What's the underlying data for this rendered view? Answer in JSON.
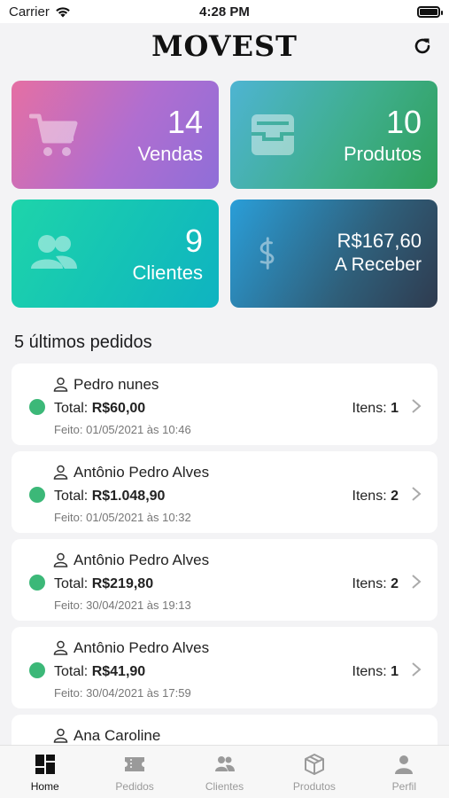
{
  "status": {
    "carrier": "Carrier",
    "time": "4:28 PM",
    "battery_level": 1.0
  },
  "header": {
    "logo": "MOVEST",
    "refresh_icon": "refresh-icon"
  },
  "cards": {
    "vendas": {
      "value": "14",
      "label": "Vendas",
      "icon": "cart-icon"
    },
    "produtos": {
      "value": "10",
      "label": "Produtos",
      "icon": "inbox-tray-icon"
    },
    "clientes": {
      "value": "9",
      "label": "Clientes",
      "icon": "users-icon"
    },
    "receber": {
      "value": "R$167,60",
      "label": "A Receber",
      "icon": "dollar-icon"
    }
  },
  "orders_section": {
    "title": "5 últimos pedidos"
  },
  "orders": [
    {
      "name": "Pedro nunes",
      "total_label": "Total:",
      "total": "R$60,00",
      "date": "Feito: 01/05/2021 às 10:46",
      "itens_label": "Itens:",
      "itens": "1",
      "status_color": "#3cb878"
    },
    {
      "name": "Antônio Pedro Alves",
      "total_label": "Total:",
      "total": "R$1.048,90",
      "date": "Feito: 01/05/2021 às 10:32",
      "itens_label": "Itens:",
      "itens": "2",
      "status_color": "#3cb878"
    },
    {
      "name": "Antônio Pedro Alves",
      "total_label": "Total:",
      "total": "R$219,80",
      "date": "Feito: 30/04/2021 às 19:13",
      "itens_label": "Itens:",
      "itens": "2",
      "status_color": "#3cb878"
    },
    {
      "name": "Antônio Pedro Alves",
      "total_label": "Total:",
      "total": "R$41,90",
      "date": "Feito: 30/04/2021 às 17:59",
      "itens_label": "Itens:",
      "itens": "1",
      "status_color": "#3cb878"
    },
    {
      "name": "Ana Caroline"
    }
  ],
  "tabs": [
    {
      "label": "Home",
      "icon": "dashboard-icon",
      "active": true
    },
    {
      "label": "Pedidos",
      "icon": "ticket-icon",
      "active": false
    },
    {
      "label": "Clientes",
      "icon": "users-icon",
      "active": false
    },
    {
      "label": "Produtos",
      "icon": "box-icon",
      "active": false
    },
    {
      "label": "Perfil",
      "icon": "person-icon",
      "active": false
    }
  ]
}
